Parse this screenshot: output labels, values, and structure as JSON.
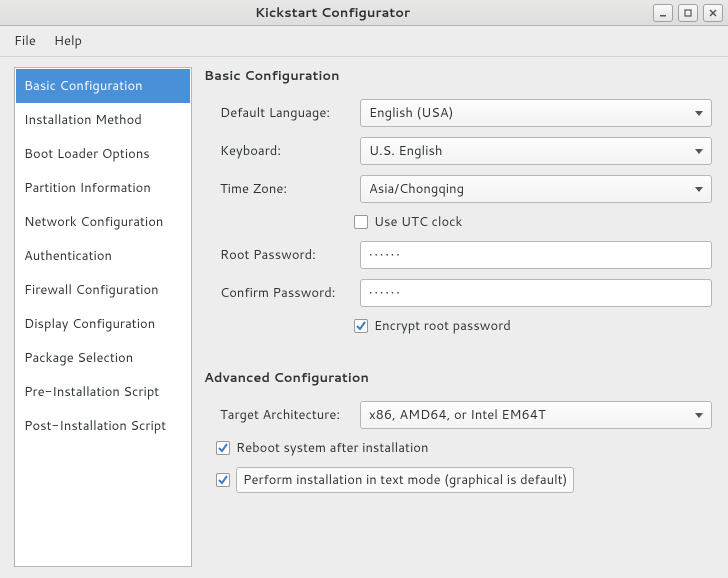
{
  "window": {
    "title": "Kickstart Configurator"
  },
  "menubar": {
    "file": "File",
    "help": "Help"
  },
  "sidebar": {
    "items": [
      {
        "label": "Basic Configuration",
        "selected": true
      },
      {
        "label": "Installation Method"
      },
      {
        "label": "Boot Loader Options"
      },
      {
        "label": "Partition Information"
      },
      {
        "label": "Network Configuration"
      },
      {
        "label": "Authentication"
      },
      {
        "label": "Firewall Configuration"
      },
      {
        "label": "Display Configuration"
      },
      {
        "label": "Package Selection"
      },
      {
        "label": "Pre-Installation Script"
      },
      {
        "label": "Post-Installation Script"
      }
    ]
  },
  "basic": {
    "heading": "Basic Configuration",
    "default_language_label": "Default Language:",
    "default_language_value": "English (USA)",
    "keyboard_label": "Keyboard:",
    "keyboard_value": "U.S. English",
    "timezone_label": "Time Zone:",
    "timezone_value": "Asia/Chongqing",
    "utc_label": "Use UTC clock",
    "utc_checked": false,
    "root_password_label": "Root Password:",
    "root_password_value": "••••••",
    "confirm_password_label": "Confirm Password:",
    "confirm_password_value": "••••••",
    "encrypt_label": "Encrypt root password",
    "encrypt_checked": true
  },
  "advanced": {
    "heading": "Advanced Configuration",
    "target_arch_label": "Target Architecture:",
    "target_arch_value": "x86, AMD64, or Intel EM64T",
    "reboot_label": "Reboot system after installation",
    "reboot_checked": true,
    "textmode_label": "Perform installation in text mode (graphical is default)",
    "textmode_checked": true
  }
}
